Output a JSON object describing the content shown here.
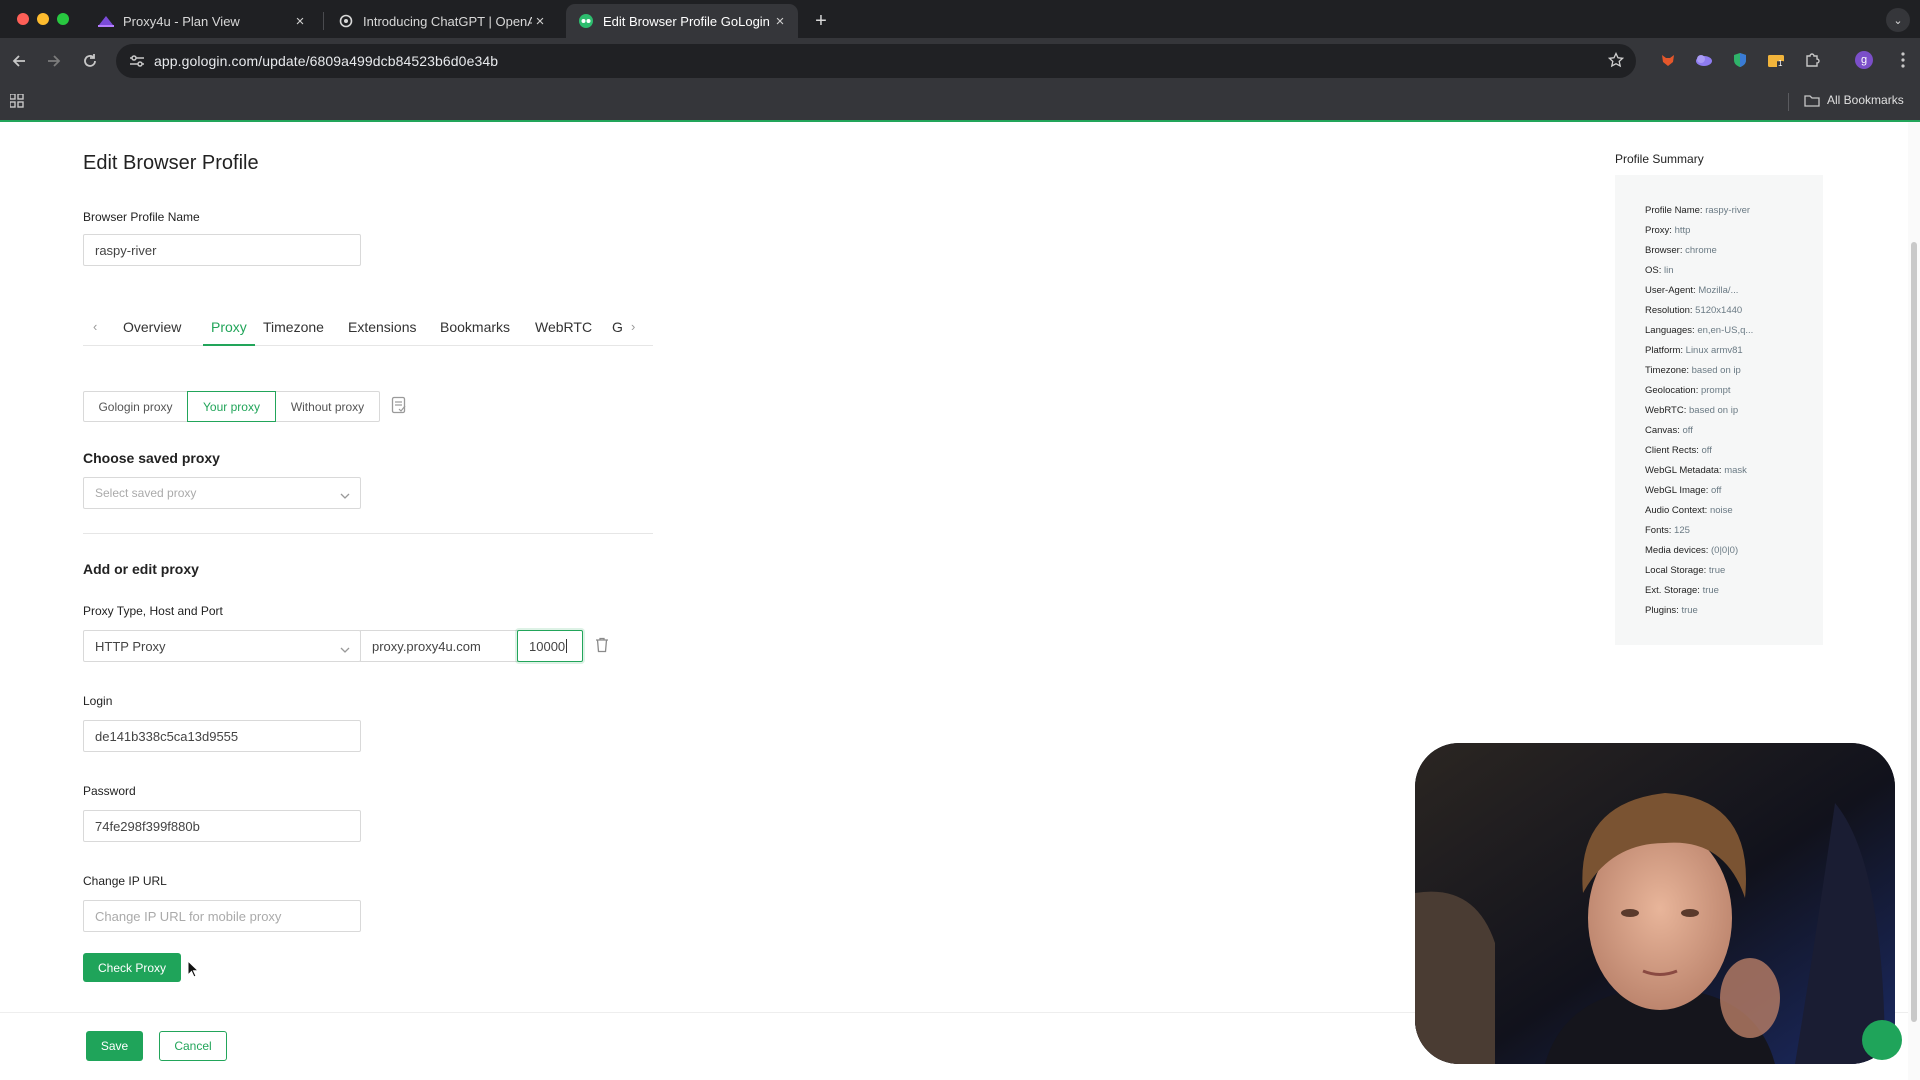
{
  "browser": {
    "tabs": [
      {
        "title": "Proxy4u - Plan View",
        "active": false,
        "favicon": "proxy4u-logo-icon"
      },
      {
        "title": "Introducing ChatGPT | OpenA",
        "active": false,
        "favicon": "openai-logo-icon"
      },
      {
        "title": "Edit Browser Profile GoLogin",
        "active": true,
        "favicon": "gologin-logo-icon"
      }
    ],
    "url": "app.gologin.com/update/6809a499dcb84523b6d0e34b",
    "bookmarks_label": "All Bookmarks",
    "profile_initial": "g",
    "extension_badge": "1"
  },
  "page": {
    "title": "Edit Browser Profile",
    "profile_name_label": "Browser Profile Name",
    "profile_name_value": "raspy-river",
    "tabs": [
      "Overview",
      "Proxy",
      "Timezone",
      "Extensions",
      "Bookmarks",
      "WebRTC",
      "G"
    ],
    "active_tab": "Proxy",
    "proxy_modes": [
      "Gologin proxy",
      "Your proxy",
      "Without proxy"
    ],
    "active_proxy_mode": "Your proxy",
    "saved_proxy": {
      "heading": "Choose saved proxy",
      "placeholder": "Select saved proxy"
    },
    "add_edit_heading": "Add or edit proxy",
    "proxy_type_label": "Proxy Type, Host and Port",
    "proxy_type_value": "HTTP Proxy",
    "host_value": "proxy.proxy4u.com",
    "port_value": "10000",
    "login_label": "Login",
    "login_value": "de141b338c5ca13d9555",
    "password_label": "Password",
    "password_value": "74fe298f399f880b",
    "change_ip_label": "Change IP URL",
    "change_ip_placeholder": "Change IP URL for mobile proxy",
    "check_proxy_button": "Check Proxy",
    "save_button": "Save",
    "cancel_button": "Cancel"
  },
  "summary": {
    "title": "Profile Summary",
    "rows": [
      {
        "key": "Profile Name:",
        "value": "raspy-river"
      },
      {
        "key": "Proxy:",
        "value": "http"
      },
      {
        "key": "Browser:",
        "value": "chrome"
      },
      {
        "key": "OS:",
        "value": "lin"
      },
      {
        "key": "User-Agent:",
        "value": "Mozilla/..."
      },
      {
        "key": "Resolution:",
        "value": "5120x1440"
      },
      {
        "key": "Languages:",
        "value": "en,en-US,q..."
      },
      {
        "key": "Platform:",
        "value": "Linux armv81"
      },
      {
        "key": "Timezone:",
        "value": "based on ip"
      },
      {
        "key": "Geolocation:",
        "value": "prompt"
      },
      {
        "key": "WebRTC:",
        "value": "based on ip"
      },
      {
        "key": "Canvas:",
        "value": "off"
      },
      {
        "key": "Client Rects:",
        "value": "off"
      },
      {
        "key": "WebGL Metadata:",
        "value": "mask"
      },
      {
        "key": "WebGL Image:",
        "value": "off"
      },
      {
        "key": "Audio Context:",
        "value": "noise"
      },
      {
        "key": "Fonts:",
        "value": "125"
      },
      {
        "key": "Media devices:",
        "value": "(0|0|0)"
      },
      {
        "key": "Local Storage:",
        "value": "true"
      },
      {
        "key": "Ext. Storage:",
        "value": "true"
      },
      {
        "key": "Plugins:",
        "value": "true"
      }
    ]
  },
  "colors": {
    "accent": "#22a55a",
    "chrome_dark": "#1f2023",
    "chrome_toolbar": "#35363a"
  }
}
